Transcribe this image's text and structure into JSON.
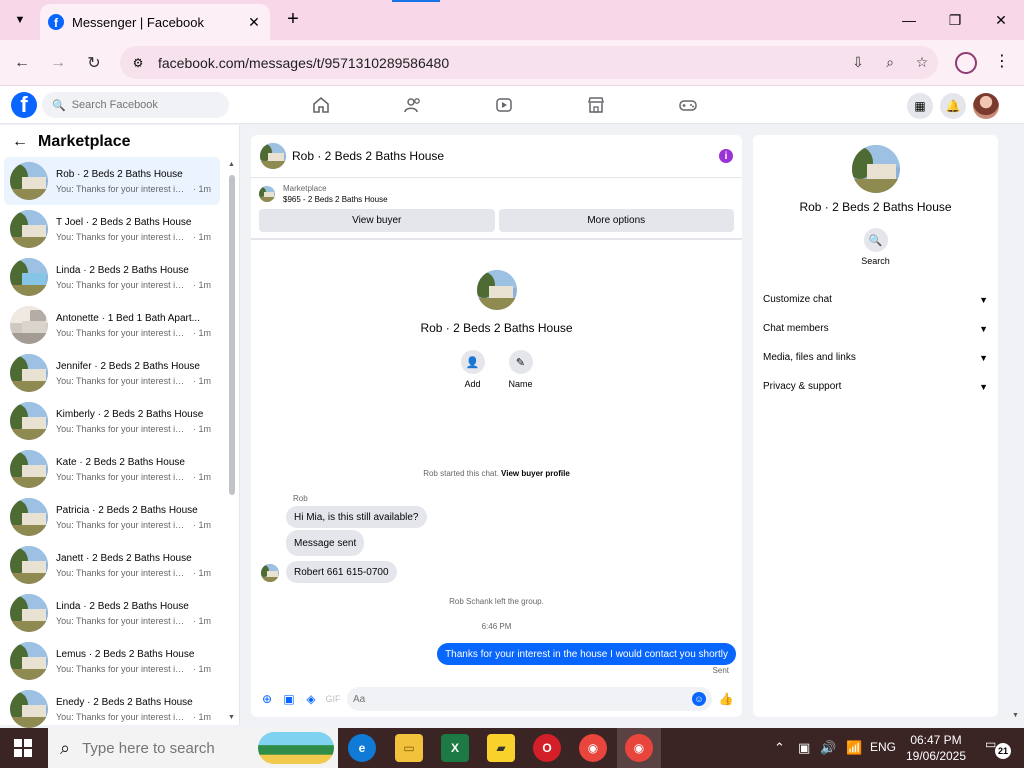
{
  "browser": {
    "tab_title": "Messenger | Facebook",
    "url": "facebook.com/messages/t/9571310289586480",
    "new_tab": "+",
    "close_tab": "✕"
  },
  "facebook": {
    "search_placeholder": "Search Facebook",
    "brand_color": "#0866ff"
  },
  "left": {
    "back_label": "←",
    "title": "Marketplace",
    "conversations": [
      {
        "name": "Rob · 2 Beds 2 Baths House",
        "snippet": "You: Thanks for your interest in t...",
        "time": "· 1m",
        "active": true,
        "thumb": "house"
      },
      {
        "name": "T Joel · 2 Beds 2 Baths House",
        "snippet": "You: Thanks for your interest in t...",
        "time": "· 1m",
        "thumb": "house"
      },
      {
        "name": "Linda · 2 Beds 2 Baths House",
        "snippet": "You: Thanks for your interest in t...",
        "time": "· 1m",
        "thumb": "blue-house"
      },
      {
        "name": "Antonette · 1 Bed 1 Bath Apart...",
        "snippet": "You: Thanks for your interest in t...",
        "time": "· 1m",
        "thumb": "apartment"
      },
      {
        "name": "Jennifer · 2 Beds 2 Baths House",
        "snippet": "You: Thanks for your interest in t...",
        "time": "· 1m",
        "thumb": "house"
      },
      {
        "name": "Kimberly · 2 Beds 2 Baths House",
        "snippet": "You: Thanks for your interest in t...",
        "time": "· 1m",
        "thumb": "house"
      },
      {
        "name": "Kate · 2 Beds 2 Baths House",
        "snippet": "You: Thanks for your interest in t...",
        "time": "· 1m",
        "thumb": "house"
      },
      {
        "name": "Patricia · 2 Beds 2 Baths House",
        "snippet": "You: Thanks for your interest in t...",
        "time": "· 1m",
        "thumb": "house"
      },
      {
        "name": "Janett · 2 Beds 2 Baths House",
        "snippet": "You: Thanks for your interest in t...",
        "time": "· 1m",
        "thumb": "house"
      },
      {
        "name": "Linda · 2 Beds 2 Baths House",
        "snippet": "You: Thanks for your interest in t...",
        "time": "· 1m",
        "thumb": "house"
      },
      {
        "name": "Lemus · 2 Beds 2 Baths House",
        "snippet": "You: Thanks for your interest in t...",
        "time": "· 1m",
        "thumb": "house"
      },
      {
        "name": "Enedy · 2 Beds 2 Baths House",
        "snippet": "You: Thanks for your interest in t...",
        "time": "· 1m",
        "thumb": "house"
      }
    ]
  },
  "chat": {
    "title": "Rob · 2 Beds 2 Baths House",
    "marketplace_label": "Marketplace",
    "listing": "$965 - 2 Beds 2 Baths House",
    "view_buyer": "View buyer",
    "more_options": "More options",
    "profile_name": "Rob · 2 Beds 2 Baths House",
    "add_label": "Add",
    "name_label": "Name",
    "started_text": "Rob started this chat.",
    "view_buyer_profile": "View buyer profile",
    "sender_name": "Rob",
    "messages_in": [
      "Hi Mia, is this still available?",
      "Message sent",
      "Robert 661 615-0700"
    ],
    "left_group": "Rob Schank left the group.",
    "time_marker": "6:46 PM",
    "message_out": "Thanks for your interest in the house I would contact you shortly",
    "sent_status": "Sent",
    "input_placeholder": "Aa"
  },
  "right": {
    "name": "Rob · 2 Beds 2 Baths House",
    "search_label": "Search",
    "sections": [
      "Customize chat",
      "Chat members",
      "Media, files and links",
      "Privacy & support"
    ]
  },
  "taskbar": {
    "search_placeholder": "Type here to search",
    "language": "ENG",
    "time": "06:47 PM",
    "date": "19/06/2025",
    "notification_count": "21"
  }
}
